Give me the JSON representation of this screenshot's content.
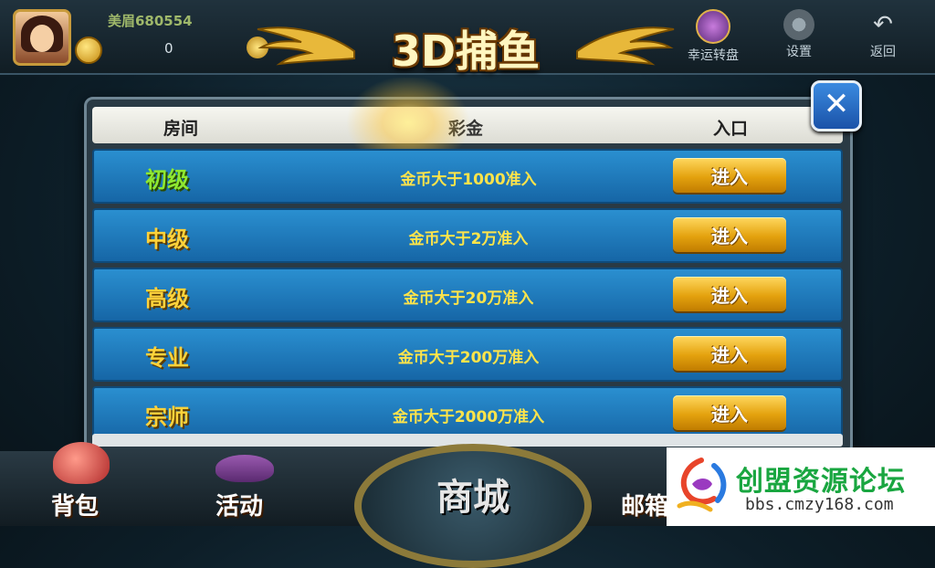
{
  "topbar": {
    "player_name": "美眉680554",
    "coins": "0",
    "right_items": [
      {
        "label": "幸运转盘",
        "icon": "lucky-wheel-icon"
      },
      {
        "label": "设置",
        "icon": "gear-icon"
      },
      {
        "label": "返回",
        "icon": "back-arrow-icon"
      }
    ]
  },
  "title": "3D捕鱼",
  "table": {
    "headers": {
      "room": "房间",
      "prize": "彩金",
      "entry": "入口"
    },
    "rows": [
      {
        "room": "初级",
        "requirement": "金币大于1000准入",
        "button": "进入"
      },
      {
        "room": "中级",
        "requirement": "金币大于2万准入",
        "button": "进入"
      },
      {
        "room": "高级",
        "requirement": "金币大于20万准入",
        "button": "进入"
      },
      {
        "room": "专业",
        "requirement": "金币大于200万准入",
        "button": "进入"
      },
      {
        "room": "宗师",
        "requirement": "金币大于2000万准入",
        "button": "进入"
      }
    ]
  },
  "bottombar": {
    "bag": "背包",
    "activity": "活动",
    "shop": "商城",
    "mail": "邮箱"
  },
  "watermark": {
    "title": "创盟资源论坛",
    "url": "bbs.cmzy168.com"
  },
  "colors": {
    "row_blue": "#1f7fc2",
    "gold": "#ffd23a",
    "green_room": "#8fe830",
    "button_gold": "#e4a20e"
  }
}
